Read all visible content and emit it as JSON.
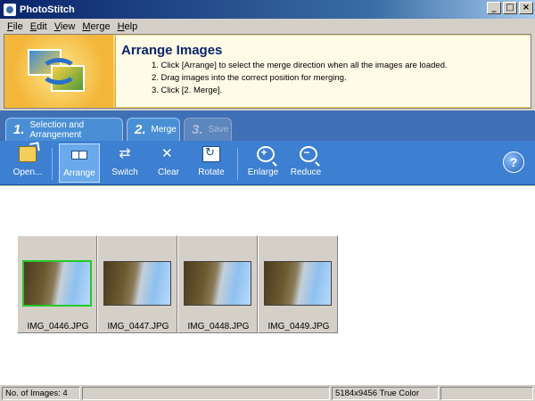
{
  "window": {
    "title": "PhotoStitch"
  },
  "menu": [
    {
      "label": "File",
      "accel": "F",
      "rest": "ile"
    },
    {
      "label": "Edit",
      "accel": "E",
      "rest": "dit"
    },
    {
      "label": "View",
      "accel": "V",
      "rest": "iew"
    },
    {
      "label": "Merge",
      "accel": "M",
      "rest": "erge"
    },
    {
      "label": "Help",
      "accel": "H",
      "rest": "elp"
    }
  ],
  "banner": {
    "title": "Arrange Images",
    "steps": [
      "1. Click [Arrange] to select the merge direction when all the images are loaded.",
      "2. Drag images into the correct position for merging.",
      "3. Click [2. Merge]."
    ]
  },
  "tabs": [
    {
      "num": "1.",
      "label": "Selection and Arrangement",
      "state": "active"
    },
    {
      "num": "2.",
      "label": "Merge",
      "state": "enabled"
    },
    {
      "num": "3.",
      "label": "Save",
      "state": "disabled"
    }
  ],
  "toolbar": {
    "open": "Open...",
    "arrange": "Arrange",
    "switch": "Switch",
    "clear": "Clear",
    "rotate": "Rotate",
    "enlarge": "Enlarge",
    "reduce": "Reduce",
    "help": "?"
  },
  "images": [
    {
      "name": "IMG_0446.JPG",
      "selected": true
    },
    {
      "name": "IMG_0447.JPG",
      "selected": false
    },
    {
      "name": "IMG_0448.JPG",
      "selected": false
    },
    {
      "name": "IMG_0449.JPG",
      "selected": false
    }
  ],
  "status": {
    "count": "No. of Images: 4",
    "info": "5184x9456 True Color"
  },
  "colors": {
    "titlebar": "#0a246a",
    "toolbar": "#3d7fd1",
    "tab_area": "#3f6fb5",
    "banner": "#f2c957",
    "selection": "#22c82a"
  }
}
